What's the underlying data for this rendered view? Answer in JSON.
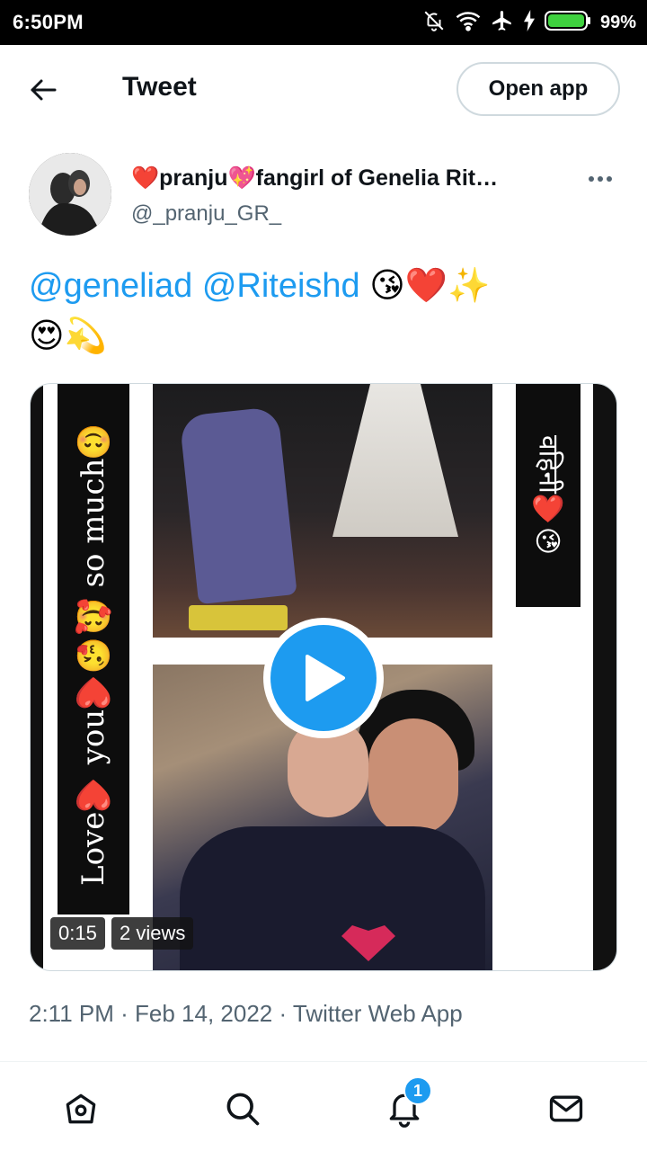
{
  "status_bar": {
    "time": "6:50PM",
    "battery_percent": "99%",
    "icons": [
      "bell-off-icon",
      "wifi-icon",
      "airplane-icon",
      "charging-icon",
      "battery-icon"
    ]
  },
  "header": {
    "back_icon": "back-arrow-icon",
    "title": "Tweet",
    "open_app_label": "Open app"
  },
  "tweet": {
    "author": {
      "display_name": "❤️pranju💖fangirl of Genelia Rit…",
      "handle": "@_pranju_GR_"
    },
    "text": {
      "mentions": [
        "@geneliad",
        "@Riteishd"
      ],
      "emojis_line1": "😘❤️✨",
      "emojis_line2": "😍💫"
    },
    "media": {
      "type": "video",
      "left_band_text": "Love❤️ you❤️😘🥰 so much😊",
      "right_band_text": "वहिनी❤️😘",
      "duration": "0:15",
      "views": "2 views"
    },
    "timestamp": "2:11 PM · Feb 14, 2022 · Twitter Web App"
  },
  "bottom_nav": {
    "items": [
      "home-icon",
      "search-icon",
      "notifications-icon",
      "messages-icon"
    ],
    "notification_badge": "1"
  },
  "colors": {
    "accent": "#1d9bf0",
    "text_primary": "#0f1419",
    "text_secondary": "#536471",
    "border": "#cfd9de"
  }
}
